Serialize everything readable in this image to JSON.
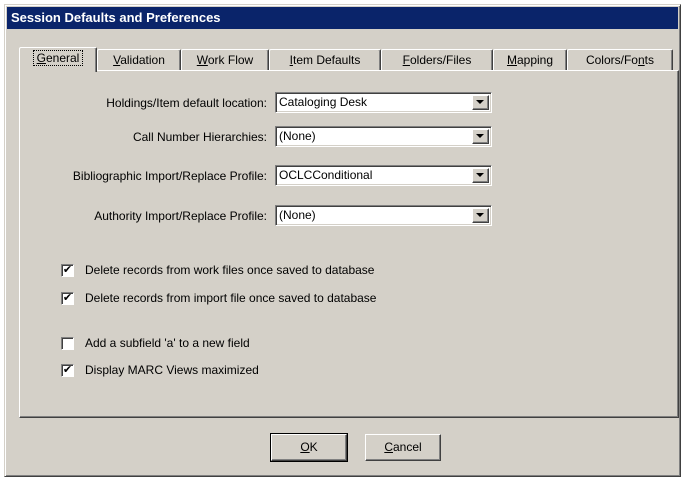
{
  "window": {
    "title": "Session Defaults and Preferences"
  },
  "tabs": [
    {
      "pre": "",
      "key": "G",
      "post": "eneral"
    },
    {
      "pre": "",
      "key": "V",
      "post": "alidation"
    },
    {
      "pre": "",
      "key": "W",
      "post": "ork Flow"
    },
    {
      "pre": "",
      "key": "I",
      "post": "tem Defaults"
    },
    {
      "pre": "",
      "key": "F",
      "post": "olders/Files"
    },
    {
      "pre": "",
      "key": "M",
      "post": "apping"
    },
    {
      "pre": "Colors/Fo",
      "key": "n",
      "post": "ts"
    }
  ],
  "fields": [
    {
      "label": "Holdings/Item default location:",
      "value": "Cataloging Desk"
    },
    {
      "label": "Call Number Hierarchies:",
      "value": "(None)"
    },
    {
      "label": "Bibliographic Import/Replace Profile:",
      "value": "OCLCConditional"
    },
    {
      "label": "Authority Import/Replace Profile:",
      "value": "(None)"
    }
  ],
  "checkboxes": [
    {
      "label": "Delete records from work files once saved to database",
      "checked": true
    },
    {
      "label": "Delete records from import file once saved to database",
      "checked": true
    },
    {
      "label": "Add a subfield 'a' to a new field",
      "checked": false
    },
    {
      "label": "Display MARC Views maximized",
      "checked": true
    }
  ],
  "buttons": {
    "ok": {
      "key": "O",
      "post": "K"
    },
    "cancel": {
      "key": "C",
      "post": "ancel"
    }
  },
  "colors": {
    "titlebar": "#0a246a",
    "face": "#d4d0c8"
  }
}
